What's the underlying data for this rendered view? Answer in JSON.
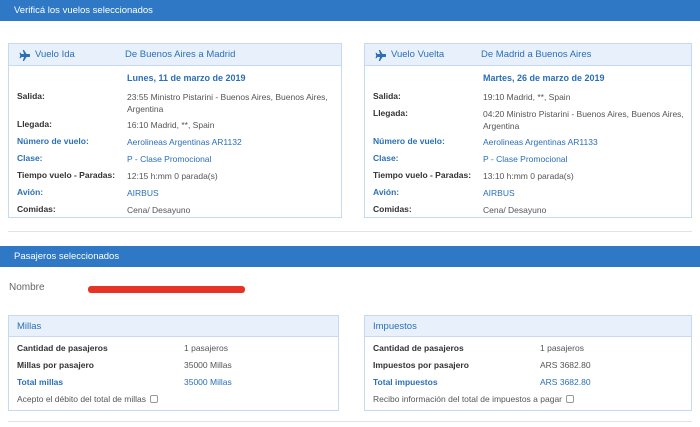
{
  "section_flights_title": "Verificá los vuelos seleccionados",
  "flights": [
    {
      "type": "Vuelo Ida",
      "route": "De Buenos Aires a Madrid",
      "date": "Lunes, 11 de marzo de 2019",
      "salida_label": "Salida:",
      "salida": "23:55 Ministro Pistarini - Buenos Aires, Buenos Aires, Argentina",
      "llegada_label": "Llegada:",
      "llegada": "16:10 Madrid, **, Spain",
      "numero_label": "Número de vuelo:",
      "numero": "Aerolineas Argentinas AR1132",
      "clase_label": "Clase:",
      "clase": "P - Clase Promocional",
      "tiempo_label": "Tiempo vuelo - Paradas:",
      "tiempo": "12:15 h:mm 0 parada(s)",
      "avion_label": "Avión:",
      "avion": "AIRBUS",
      "comidas_label": "Comidas:",
      "comidas": "Cena/ Desayuno"
    },
    {
      "type": "Vuelo Vuelta",
      "route": "De Madrid a Buenos Aires",
      "date": "Martes, 26 de marzo de 2019",
      "salida_label": "Salida:",
      "salida": "19:10 Madrid, **, Spain",
      "llegada_label": "Llegada:",
      "llegada": "04:20 Ministro Pistarini - Buenos Aires, Buenos Aires, Argentina",
      "numero_label": "Número de vuelo:",
      "numero": "Aerolineas Argentinas AR1133",
      "clase_label": "Clase:",
      "clase": "P - Clase Promocional",
      "tiempo_label": "Tiempo vuelo - Paradas:",
      "tiempo": "13:10 h:mm 0 parada(s)",
      "avion_label": "Avión:",
      "avion": "AIRBUS",
      "comidas_label": "Comidas:",
      "comidas": "Cena/ Desayuno"
    }
  ],
  "section_passengers_title": "Pasajeros seleccionados",
  "nombre_label": "Nombre",
  "millas": {
    "title": "Millas",
    "cantidad_label": "Cantidad de pasajeros",
    "cantidad": "1 pasajeros",
    "por_pasajero_label": "Millas por pasajero",
    "por_pasajero": "35000 Millas",
    "total_label": "Total millas",
    "total": "35000 Millas",
    "accept_label": "Acepto el débito del total de millas"
  },
  "impuestos": {
    "title": "Impuestos",
    "cantidad_label": "Cantidad de pasajeros",
    "cantidad": "1 pasajeros",
    "por_pasajero_label": "Impuestos por pasajero",
    "por_pasajero": "ARS 3682.80",
    "total_label": "Total impuestos",
    "total": "ARS 3682.80",
    "accept_label": "Recibo información del total de impuestos a pagar"
  },
  "colors": {
    "header_blue": "#2e78c6",
    "accent_blue": "#2a6fb7",
    "redaction": "#e63323"
  }
}
